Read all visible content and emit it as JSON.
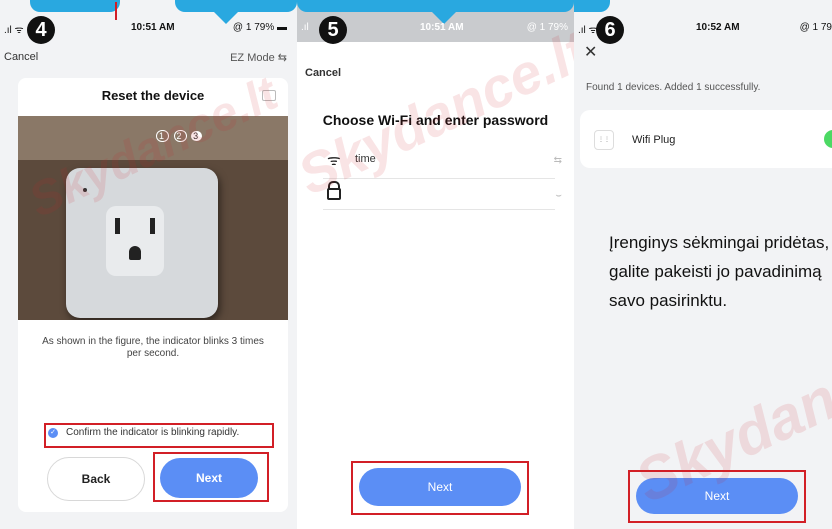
{
  "steps": [
    {
      "number": "4",
      "status_time": "10:51 AM",
      "status_right": "@ 1 79%",
      "cancel": "Cancel",
      "mode": "EZ Mode",
      "title": "Reset the device",
      "indicator_dots": [
        "1",
        "2",
        "3"
      ],
      "instruction": "As shown in the figure, the indicator blinks 3 times per second.",
      "confirm": "Confirm the indicator is blinking rapidly.",
      "back": "Back",
      "next": "Next"
    },
    {
      "number": "5",
      "status_time": "10:51 AM",
      "status_right": "@ 1 79%",
      "cancel": "Cancel",
      "title": "Choose Wi-Fi and enter password",
      "wifi_name": "time",
      "next": "Next"
    },
    {
      "number": "6",
      "status_time": "10:52 AM",
      "status_right": "@ 1 79",
      "found": "Found 1 devices. Added 1 successfully.",
      "device_name": "Wifi Plug",
      "note": "Įrenginys sėkmingai pridėtas, galite pakeisti jo pavadinimą savo pasirinktu.",
      "next": "Next"
    }
  ],
  "watermarks": [
    "Skydance.lt",
    "Skydance.lt",
    "Skydance.lt"
  ],
  "colors": {
    "accent": "#5b8ef5",
    "highlight": "#d21f26",
    "tab": "#29a8e0",
    "toggle": "#4cd964"
  }
}
